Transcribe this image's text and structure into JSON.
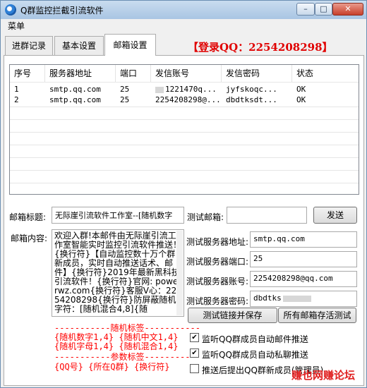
{
  "window": {
    "title": "Q群监控拦截引流软件",
    "min_icon": "minimize-icon",
    "max_icon": "maximize-icon",
    "close_icon": "close-icon"
  },
  "menu": {
    "label": "菜单"
  },
  "tabs": [
    {
      "label": "进群记录"
    },
    {
      "label": "基本设置"
    },
    {
      "label": "邮箱设置"
    }
  ],
  "login_banner": "【登录QQ：2254208298】",
  "table": {
    "headers": [
      "序号",
      "服务器地址",
      "端口",
      "发信账号",
      "发信密码",
      "状态"
    ],
    "rows": [
      {
        "index": "1",
        "server": "smtp.qq.com",
        "port": "25",
        "account": "1221470q...",
        "password": "jyfskoqc...",
        "status": "OK"
      },
      {
        "index": "2",
        "server": "smtp.qq.com",
        "port": "25",
        "account": "2254208298@...",
        "password": "dbdtksdt...",
        "status": "OK"
      }
    ]
  },
  "mail": {
    "subject_label": "邮箱标题:",
    "subject_value": "无际崖引流软件工作室--[随机数字",
    "test_mail_label": "测试邮箱:",
    "test_mail_value": "",
    "send_label": "发送",
    "content_label": "邮箱内容:",
    "content_text": "欢迎入群!本邮件由无际崖引流工作室智能实时监控引流软件推送！{换行符}【自动监控数十万个群新成员，实时自动推送话术、邮件】{换行符}2019年最新黑科技引流软件！{换行符}官网: powerwz.com{换行符}客服V心：2254208298{换行符}防屏蔽随机字符：[随机混合4,8]{随",
    "random_header": "-----------随机标签-----------",
    "random_line1": "{随机数字1,4} {随机中文1,4}",
    "random_line2": "{随机字母1,4} {随机混合1,4}",
    "param_header": "-----------参数标签-----------",
    "param_line": "{QQ号} {所在Q群} {换行符}"
  },
  "server": {
    "address_label": "测试服务器地址:",
    "address_value": "smtp.qq.com",
    "port_label": "测试服务器端口:",
    "port_value": "25",
    "account_label": "测试服务器账号:",
    "account_value": "2254208298@qq.com",
    "password_label": "测试服务器密码:",
    "password_value": "dbdtks",
    "test_save_label": "测试链接并保存",
    "test_all_label": "所有邮箱存活测试"
  },
  "options": [
    {
      "label": "监听QQ群成员自动邮件推送",
      "checked": true
    },
    {
      "label": "监听QQ群成员自动私聊推送",
      "checked": true
    },
    {
      "label": "推送后提出QQ群新成员(管理员)",
      "checked": false
    }
  ],
  "watermark": "赚也网赚论坛",
  "colors": {
    "accent_red": "#e00000",
    "tag_red": "#ff0000",
    "title_bar": "#a9c5e3"
  }
}
